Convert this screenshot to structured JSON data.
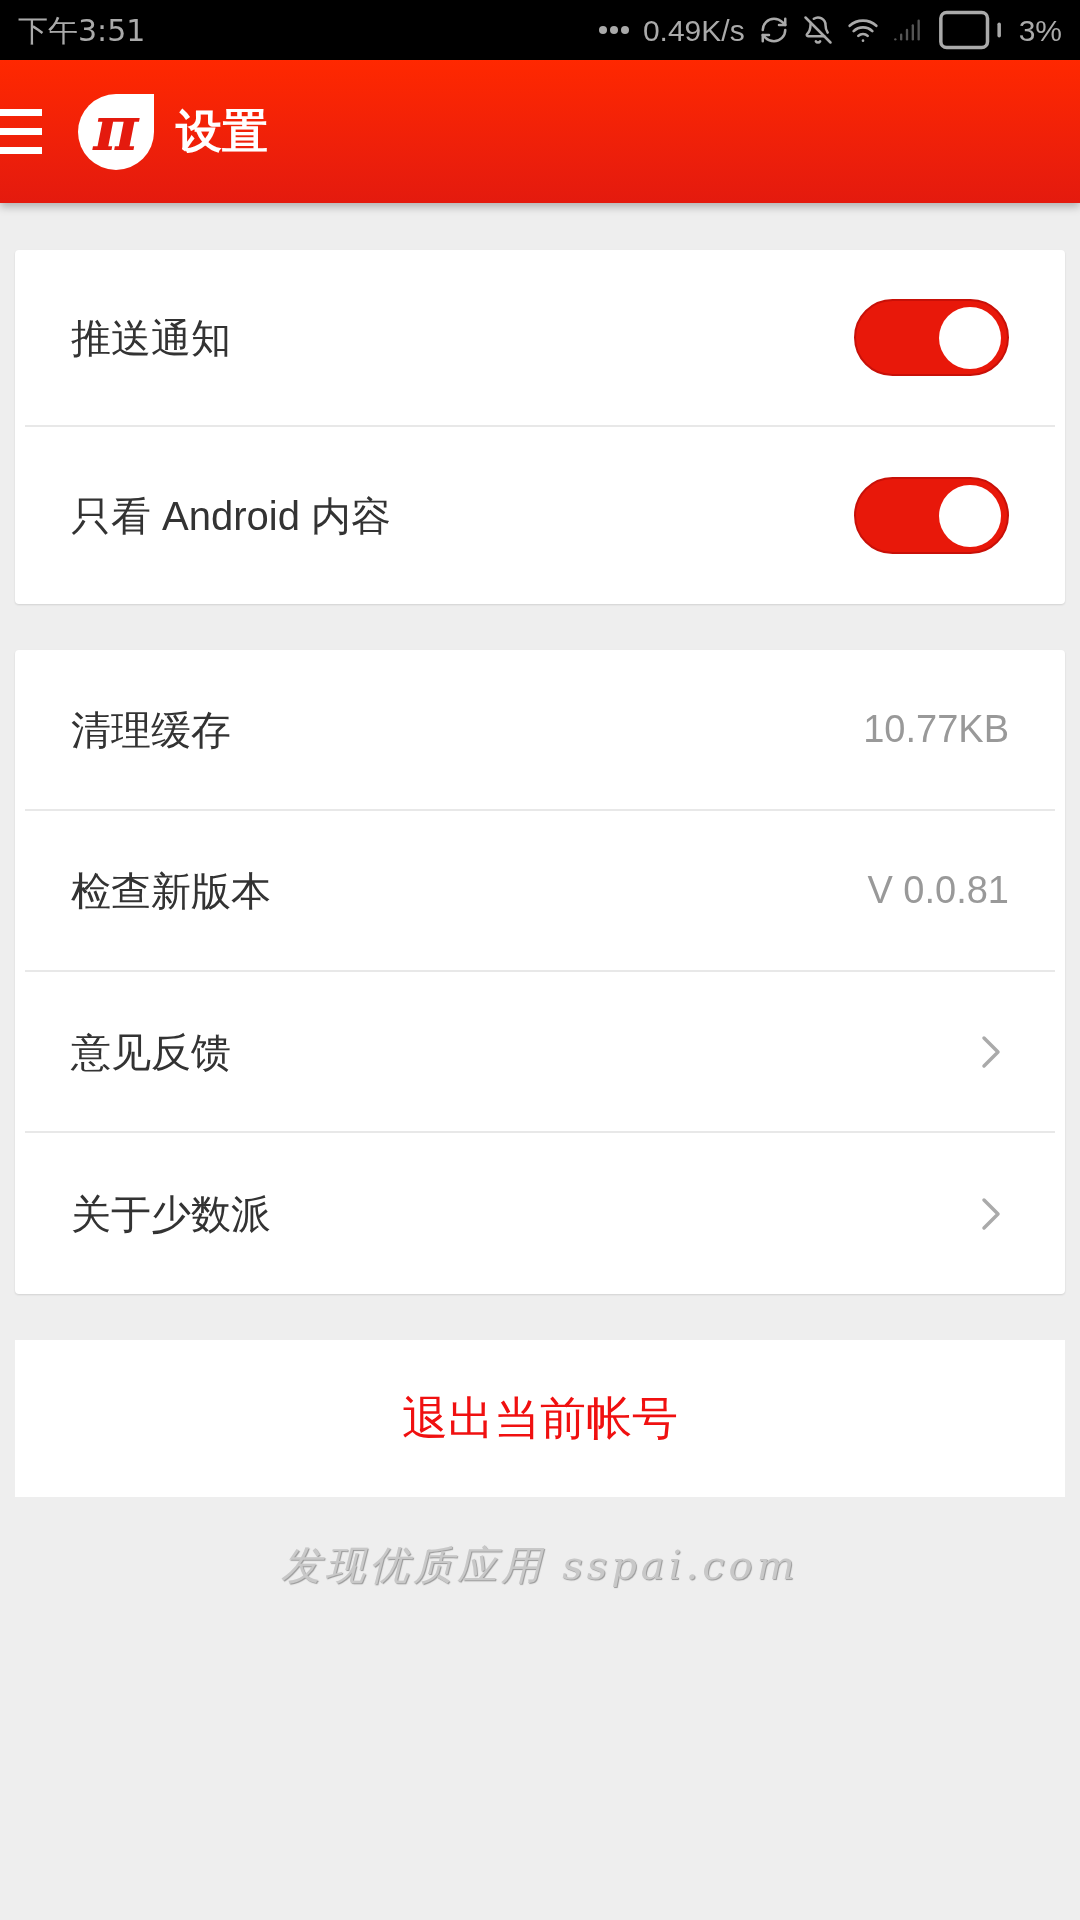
{
  "status_bar": {
    "time": "下午3:51",
    "speed": "0.49K/s",
    "battery": "3%"
  },
  "header": {
    "logo_text": "π",
    "title": "设置"
  },
  "groups": [
    {
      "items": [
        {
          "kind": "toggle",
          "label": "推送通知",
          "on": true
        },
        {
          "kind": "toggle",
          "label": "只看 Android 内容",
          "on": true
        }
      ]
    },
    {
      "items": [
        {
          "kind": "value",
          "label": "清理缓存",
          "value": "10.77KB"
        },
        {
          "kind": "value",
          "label": "检查新版本",
          "value": "V 0.0.81"
        },
        {
          "kind": "link",
          "label": "意见反馈"
        },
        {
          "kind": "link",
          "label": "关于少数派"
        }
      ]
    }
  ],
  "logout_button": "退出当前帐号",
  "footer": "发现优质应用 sspai.com"
}
